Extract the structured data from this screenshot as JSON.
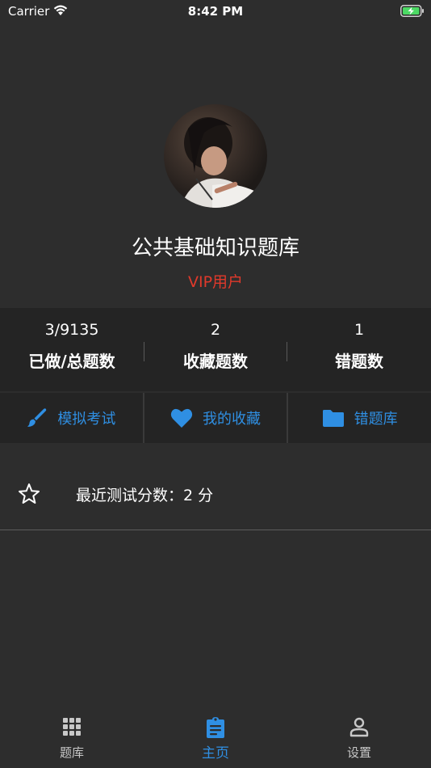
{
  "status_bar": {
    "carrier": "Carrier",
    "time": "8:42 PM"
  },
  "profile": {
    "title": "公共基础知识题库",
    "vip_label": "VIP用户"
  },
  "stats": [
    {
      "value": "3/9135",
      "label": "已做/总题数"
    },
    {
      "value": "2",
      "label": "收藏题数"
    },
    {
      "value": "1",
      "label": "错题数"
    }
  ],
  "actions": [
    {
      "label": "模拟考试",
      "icon": "paintbrush-icon"
    },
    {
      "label": "我的收藏",
      "icon": "heart-icon"
    },
    {
      "label": "错题库",
      "icon": "folder-icon"
    }
  ],
  "recent_score": {
    "text": "最近测试分数：2 分",
    "icon": "star-outline-icon"
  },
  "tab_bar": {
    "items": [
      {
        "label": "题库",
        "icon": "grid-icon",
        "active": false
      },
      {
        "label": "主页",
        "icon": "clipboard-icon",
        "active": true
      },
      {
        "label": "设置",
        "icon": "person-icon",
        "active": false
      }
    ]
  },
  "colors": {
    "background": "#2d2d2d",
    "panel": "#242424",
    "accent": "#2f8fe3",
    "vip": "#e0392b",
    "battery": "#4cd964"
  }
}
